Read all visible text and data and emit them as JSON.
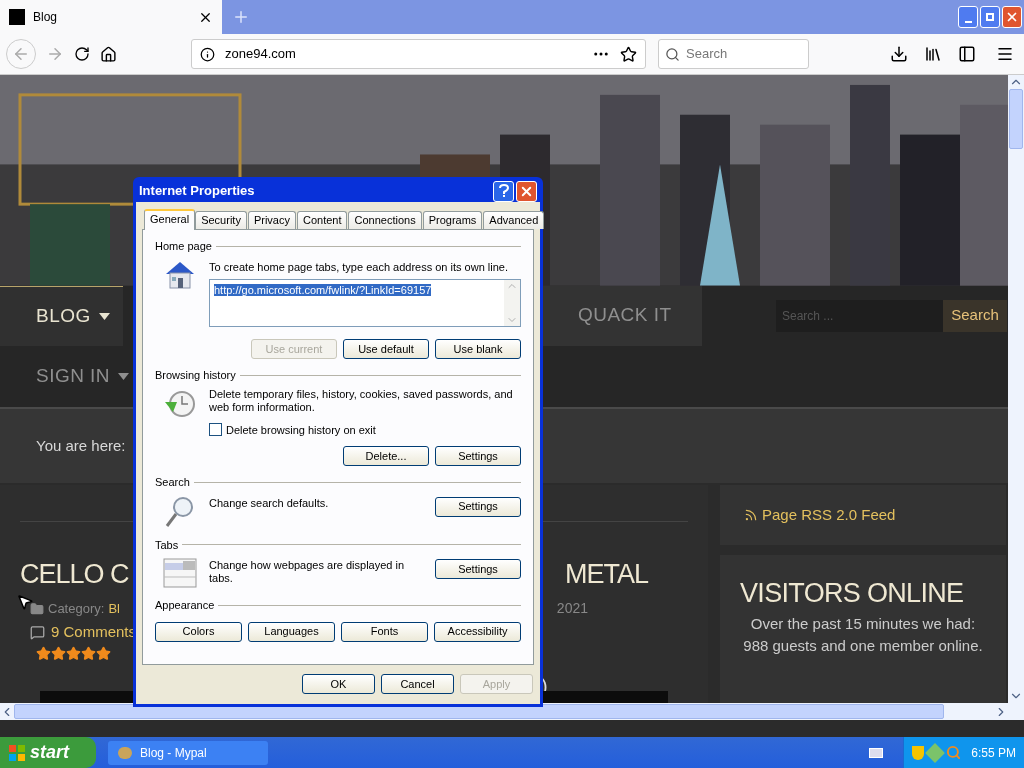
{
  "browser": {
    "tab": {
      "title": "Blog"
    },
    "address": "zone94.com",
    "search_placeholder": "Search"
  },
  "site": {
    "nav": [
      {
        "label": "BLOG",
        "dropdown": true
      },
      {
        "label": "QUACK IT",
        "dropdown": false
      },
      {
        "label": "SIGN IN",
        "dropdown": true
      }
    ],
    "search": {
      "placeholder": "Search ...",
      "button": "Search"
    },
    "breadcrumb": "You are here:",
    "post": {
      "title_start": "CELLO C",
      "title_end": "METAL",
      "category_label": "Category:",
      "category": "Bl",
      "date": "2021",
      "comments": "9 Comments",
      "stars": 5,
      "fragment": ")"
    },
    "sidebar": {
      "rss": "Page RSS 2.0 Feed",
      "visitors_title": "VISITORS ONLINE",
      "visitors_text": "Over the past 15 minutes we had: 988 guests and one member online."
    }
  },
  "dialog": {
    "title": "Internet Properties",
    "tabs": [
      {
        "label": "General",
        "selected": true
      },
      {
        "label": "Security",
        "selected": false
      },
      {
        "label": "Privacy",
        "selected": false
      },
      {
        "label": "Content",
        "selected": false
      },
      {
        "label": "Connections",
        "selected": false
      },
      {
        "label": "Programs",
        "selected": false
      },
      {
        "label": "Advanced",
        "selected": false
      }
    ],
    "sections": [
      {
        "title": "Home page",
        "kind": "homepage",
        "text": "To create home page tabs, type each address on its own line.",
        "value": "http://go.microsoft.com/fwlink/?LinkId=69157",
        "buttons": [
          {
            "label": "Use current",
            "disabled": true
          },
          {
            "label": "Use default",
            "disabled": false
          },
          {
            "label": "Use blank",
            "disabled": false
          }
        ]
      },
      {
        "title": "Browsing history",
        "kind": "history",
        "text": "Delete temporary files, history, cookies, saved passwords, and web form information.",
        "checkbox": {
          "label": "Delete browsing history on exit",
          "checked": false
        },
        "buttons": [
          {
            "label": "Delete...",
            "disabled": false
          },
          {
            "label": "Settings",
            "disabled": false
          }
        ]
      },
      {
        "title": "Search",
        "kind": "search",
        "text": "Change search defaults.",
        "buttons": [
          {
            "label": "Settings",
            "disabled": false
          }
        ]
      },
      {
        "title": "Tabs",
        "kind": "tabs",
        "text": "Change how webpages are displayed in tabs.",
        "buttons": [
          {
            "label": "Settings",
            "disabled": false
          }
        ]
      },
      {
        "title": "Appearance",
        "kind": "appearance",
        "buttons": [
          {
            "label": "Colors",
            "disabled": false
          },
          {
            "label": "Languages",
            "disabled": false
          },
          {
            "label": "Fonts",
            "disabled": false
          },
          {
            "label": "Accessibility",
            "disabled": false
          }
        ]
      }
    ],
    "footer": [
      {
        "label": "OK",
        "disabled": false
      },
      {
        "label": "Cancel",
        "disabled": false
      },
      {
        "label": "Apply",
        "disabled": true
      }
    ]
  },
  "taskbar": {
    "start": "start",
    "tasks": [
      {
        "label": "Blog - Mypal",
        "selected": false
      }
    ],
    "clock": "6:55 PM"
  }
}
